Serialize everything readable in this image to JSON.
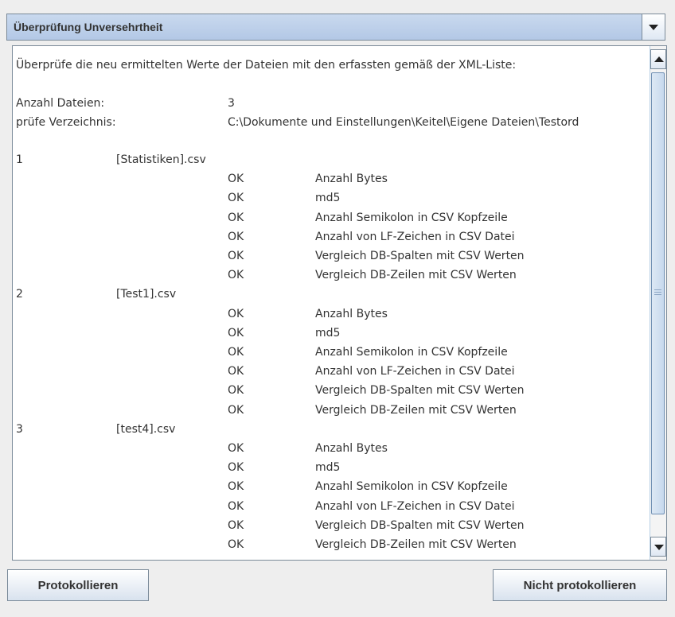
{
  "panel": {
    "title": "Überprüfung Unversehrtheit"
  },
  "content": {
    "intro": "Überprüfe die neu ermittelten Werte der Dateien mit den erfassten gemäß der XML-Liste:",
    "file_count_label": "Anzahl Dateien:",
    "file_count_value": "3",
    "dir_label": "prüfe Verzeichnis:",
    "dir_value": "C:\\Dokumente und Einstellungen\\Keitel\\Eigene Dateien\\Testord",
    "files": [
      {
        "index": "1",
        "name": "[Statistiken].csv",
        "checks": [
          {
            "status": "OK",
            "label": "Anzahl Bytes"
          },
          {
            "status": "OK",
            "label": "md5"
          },
          {
            "status": "OK",
            "label": "Anzahl Semikolon in CSV Kopfzeile"
          },
          {
            "status": "OK",
            "label": "Anzahl von LF-Zeichen in CSV Datei"
          },
          {
            "status": "OK",
            "label": "Vergleich DB-Spalten mit CSV Werten"
          },
          {
            "status": "OK",
            "label": "Vergleich DB-Zeilen mit CSV Werten"
          }
        ]
      },
      {
        "index": "2",
        "name": "[Test1].csv",
        "checks": [
          {
            "status": "OK",
            "label": "Anzahl Bytes"
          },
          {
            "status": "OK",
            "label": "md5"
          },
          {
            "status": "OK",
            "label": "Anzahl Semikolon in CSV Kopfzeile"
          },
          {
            "status": "OK",
            "label": "Anzahl von LF-Zeichen in CSV Datei"
          },
          {
            "status": "OK",
            "label": "Vergleich DB-Spalten mit CSV Werten"
          },
          {
            "status": "OK",
            "label": "Vergleich DB-Zeilen mit CSV Werten"
          }
        ]
      },
      {
        "index": "3",
        "name": "[test4].csv",
        "checks": [
          {
            "status": "OK",
            "label": "Anzahl Bytes"
          },
          {
            "status": "OK",
            "label": "md5"
          },
          {
            "status": "OK",
            "label": "Anzahl Semikolon in CSV Kopfzeile"
          },
          {
            "status": "OK",
            "label": "Anzahl von LF-Zeichen in CSV Datei"
          },
          {
            "status": "OK",
            "label": "Vergleich DB-Spalten mit CSV Werten"
          },
          {
            "status": "OK",
            "label": "Vergleich DB-Zeilen mit CSV Werten"
          }
        ]
      }
    ]
  },
  "buttons": {
    "log": "Protokollieren",
    "no_log": "Nicht protokollieren"
  },
  "icons": {
    "dropdown": "chevron-down-icon",
    "scroll_up": "arrow-up-icon",
    "scroll_down": "arrow-down-icon",
    "grip": "scroll-grip-icon"
  }
}
